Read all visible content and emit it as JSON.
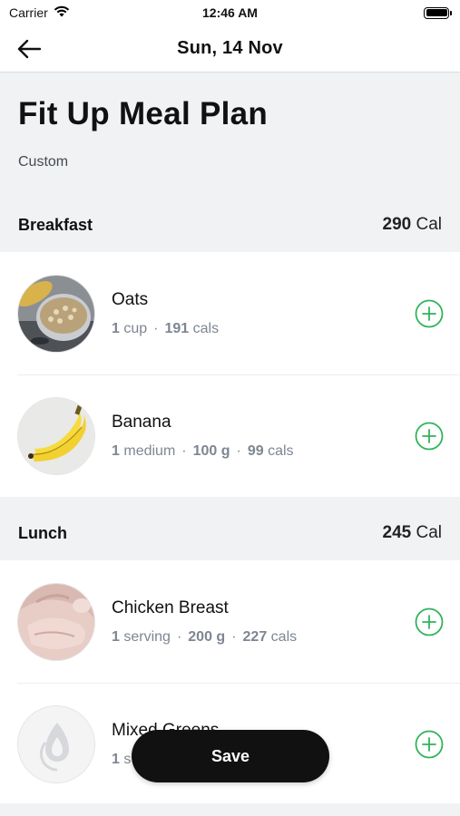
{
  "status_bar": {
    "carrier": "Carrier",
    "time": "12:46 AM"
  },
  "nav": {
    "title": "Sun, 14 Nov"
  },
  "plan": {
    "title": "Fit Up Meal Plan",
    "subtitle": "Custom"
  },
  "sections": [
    {
      "title": "Breakfast",
      "cal_value": "290",
      "cal_unit": "Cal",
      "items": [
        {
          "name": "Oats",
          "qty": "1",
          "unit": "cup",
          "weight": "",
          "cals": "191",
          "cals_unit": "cals",
          "thumb": "oats-image"
        },
        {
          "name": "Banana",
          "qty": "1",
          "unit": "medium",
          "weight": "100 g",
          "cals": "99",
          "cals_unit": "cals",
          "thumb": "banana-image"
        }
      ]
    },
    {
      "title": "Lunch",
      "cal_value": "245",
      "cal_unit": "Cal",
      "items": [
        {
          "name": "Chicken Breast",
          "qty": "1",
          "unit": "serving",
          "weight": "200 g",
          "cals": "227",
          "cals_unit": "cals",
          "thumb": "chicken-image"
        },
        {
          "name": "Mixed Greens",
          "qty": "1",
          "unit": "s",
          "weight": "",
          "cals": "",
          "cals_unit": "",
          "thumb": "placeholder-food-icon"
        }
      ]
    }
  ],
  "save_label": "Save",
  "colors": {
    "accent_green": "#2fb35a",
    "save_bg": "#111111",
    "meta_gray": "#7d8692",
    "section_bg": "#f1f2f4"
  }
}
